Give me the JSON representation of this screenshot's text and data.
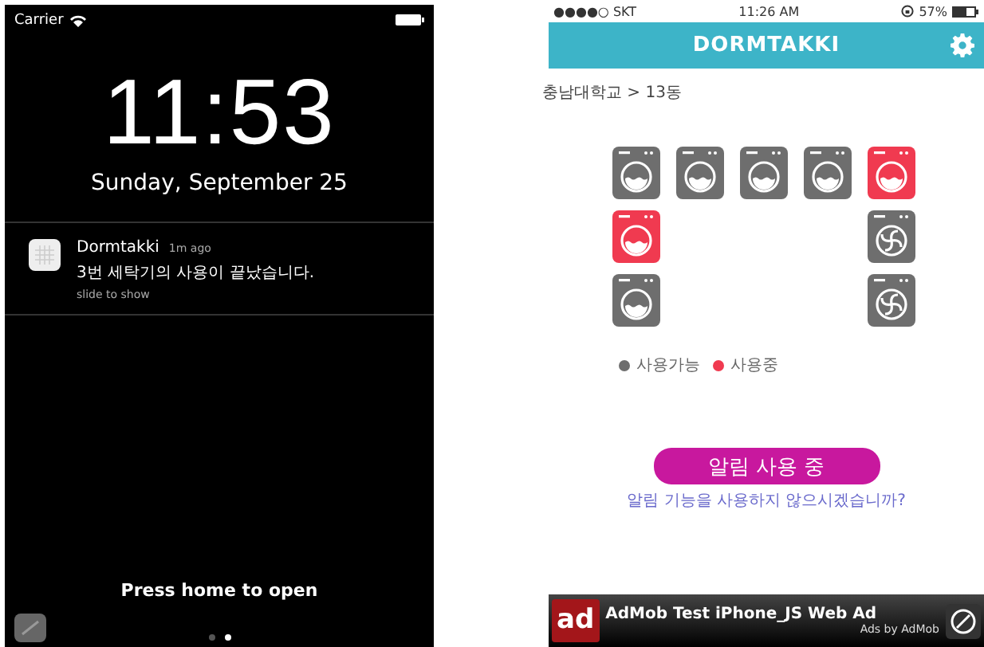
{
  "left_screen": {
    "status_bar": {
      "carrier": "Carrier"
    },
    "time": "11:53",
    "date": "Sunday, September 25",
    "notification": {
      "app": "Dormtakki",
      "age": "1m ago",
      "message": "3번 세탁기의 사용이 끝났습니다.",
      "hint": "slide to show"
    },
    "unlock_hint": "Press home to open",
    "pages": [
      {
        "selected": false
      },
      {
        "selected": true
      }
    ]
  },
  "right_screen": {
    "status_bar": {
      "carrier": "●●●●○ SKT",
      "time": "11:26 AM",
      "battery": "57%"
    },
    "header": {
      "title": "DORMTAKKI"
    },
    "breadcrumb": "충남대학교 > 13동",
    "machines": {
      "top_row": [
        {
          "kind": "washer",
          "in_use": false
        },
        {
          "kind": "washer",
          "in_use": false
        },
        {
          "kind": "washer",
          "in_use": false
        },
        {
          "kind": "washer",
          "in_use": false
        },
        {
          "kind": "washer",
          "in_use": true
        }
      ],
      "left_column": [
        {
          "kind": "washer",
          "in_use": true
        },
        {
          "kind": "washer",
          "in_use": false
        }
      ],
      "right_column": [
        {
          "kind": "dryer",
          "in_use": false
        },
        {
          "kind": "dryer",
          "in_use": false
        }
      ]
    },
    "legend": [
      {
        "label": "사용가능",
        "color": "#6e6e6e"
      },
      {
        "label": "사용중",
        "color": "#f03a50"
      }
    ],
    "alarm_button": "알림 사용 중",
    "alarm_prompt": "알림 기능을 사용하지 않으시겠습니까?",
    "ad": {
      "logo": "ad",
      "title": "AdMob Test iPhone_JS Web Ad",
      "credit": "Ads by AdMob"
    }
  }
}
